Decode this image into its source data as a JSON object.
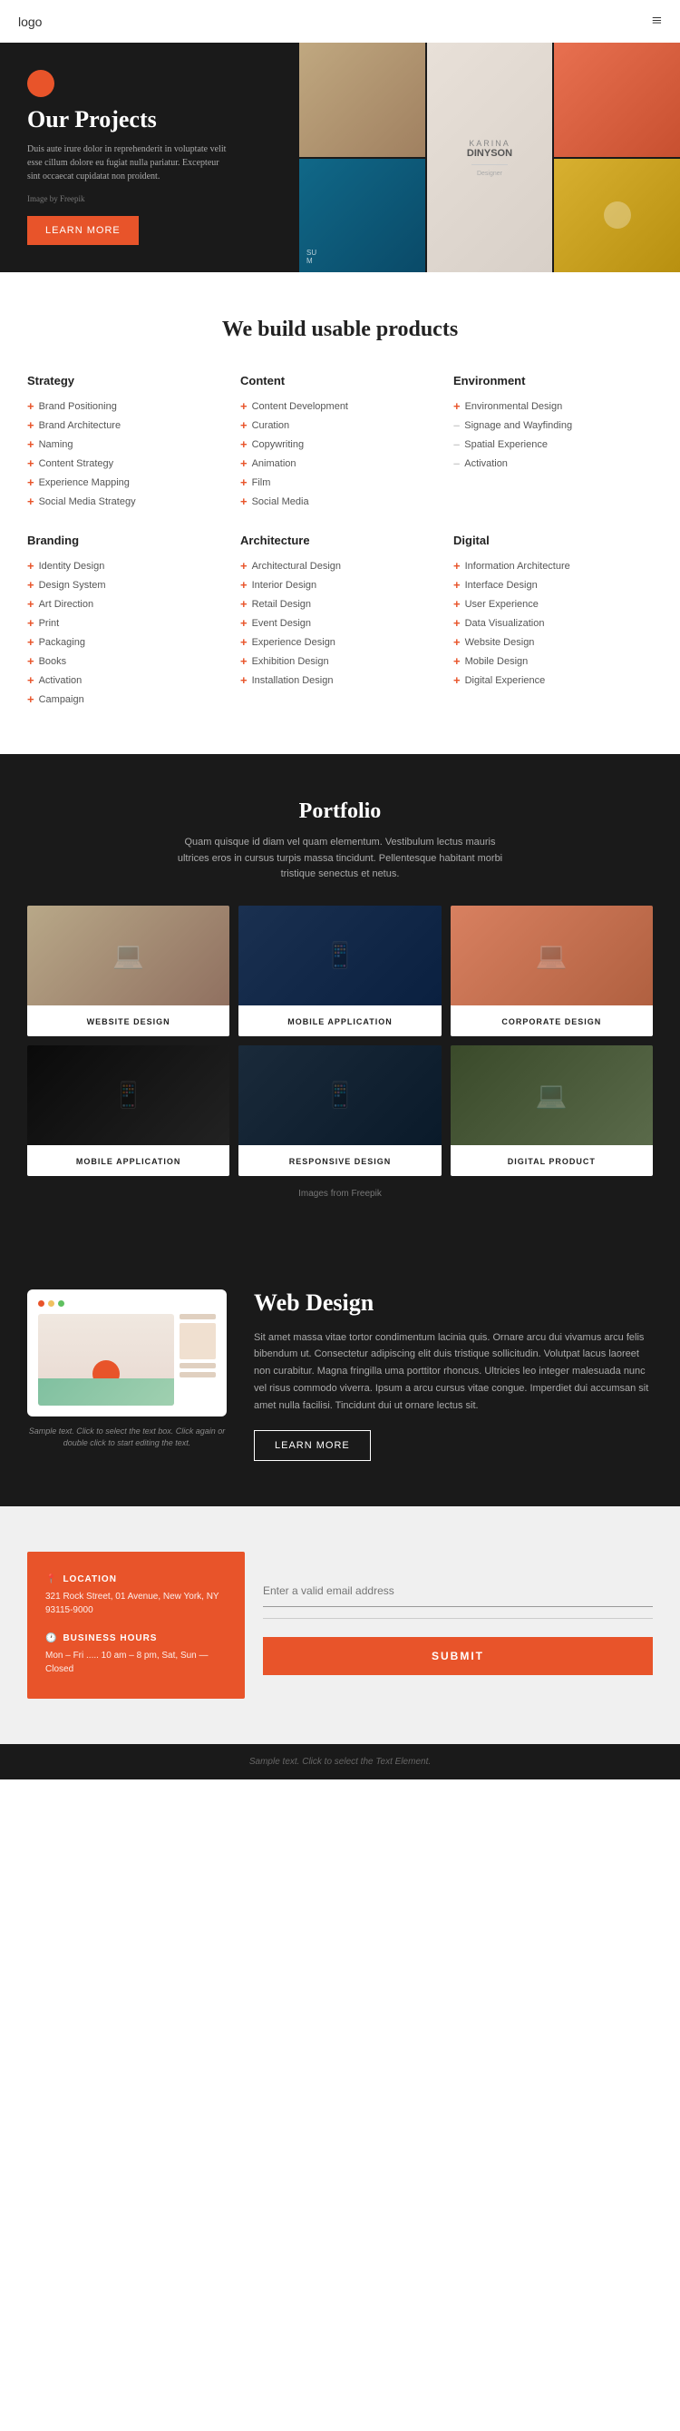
{
  "header": {
    "logo": "logo",
    "hamburger": "≡"
  },
  "hero": {
    "title": "Our Projects",
    "text": "Duis aute irure dolor in reprehenderit in voluptate velit esse cillum dolore eu fugiat nulla pariatur. Excepteur sint occaecat cupidatat non proident.",
    "image_credit": "Image by Freepik",
    "button_label": "LEARN MORE",
    "card_name": "KARINA",
    "card_surname": "DINYSON"
  },
  "services": {
    "title": "We build usable products",
    "columns": [
      {
        "heading": "Strategy",
        "items": [
          {
            "label": "Brand Positioning",
            "icon": "+"
          },
          {
            "label": "Brand Architecture",
            "icon": "+"
          },
          {
            "label": "Naming",
            "icon": "+"
          },
          {
            "label": "Content Strategy",
            "icon": "+"
          },
          {
            "label": "Experience Mapping",
            "icon": "+"
          },
          {
            "label": "Social Media Strategy",
            "icon": "+"
          }
        ]
      },
      {
        "heading": "Content",
        "items": [
          {
            "label": "Content Development",
            "icon": "+"
          },
          {
            "label": "Curation",
            "icon": "+"
          },
          {
            "label": "Copywriting",
            "icon": "+"
          },
          {
            "label": "Animation",
            "icon": "+"
          },
          {
            "label": "Film",
            "icon": "+"
          },
          {
            "label": "Social Media",
            "icon": "+"
          }
        ]
      },
      {
        "heading": "Environment",
        "items": [
          {
            "label": "Environmental Design",
            "icon": "+"
          },
          {
            "label": "Signage and Wayfinding",
            "icon": "–"
          },
          {
            "label": "Spatial Experience",
            "icon": "–"
          },
          {
            "label": "Activation",
            "icon": "–"
          }
        ]
      },
      {
        "heading": "Branding",
        "items": [
          {
            "label": "Identity Design",
            "icon": "+"
          },
          {
            "label": "Design System",
            "icon": "+"
          },
          {
            "label": "Art Direction",
            "icon": "+"
          },
          {
            "label": "Print",
            "icon": "+"
          },
          {
            "label": "Packaging",
            "icon": "+"
          },
          {
            "label": "Books",
            "icon": "+"
          },
          {
            "label": "Activation",
            "icon": "+"
          },
          {
            "label": "Campaign",
            "icon": "+"
          }
        ]
      },
      {
        "heading": "Architecture",
        "items": [
          {
            "label": "Architectural Design",
            "icon": "+"
          },
          {
            "label": "Interior Design",
            "icon": "+"
          },
          {
            "label": "Retail Design",
            "icon": "+"
          },
          {
            "label": "Event Design",
            "icon": "+"
          },
          {
            "label": "Experience Design",
            "icon": "+"
          },
          {
            "label": "Exhibition Design",
            "icon": "+"
          },
          {
            "label": "Installation Design",
            "icon": "+"
          }
        ]
      },
      {
        "heading": "Digital",
        "items": [
          {
            "label": "Information Architecture",
            "icon": "+"
          },
          {
            "label": "Interface Design",
            "icon": "+"
          },
          {
            "label": "User Experience",
            "icon": "+"
          },
          {
            "label": "Data Visualization",
            "icon": "+"
          },
          {
            "label": "Website Design",
            "icon": "+"
          },
          {
            "label": "Mobile Design",
            "icon": "+"
          },
          {
            "label": "Digital Experience",
            "icon": "+"
          }
        ]
      }
    ]
  },
  "portfolio": {
    "title": "Portfolio",
    "text": "Quam quisque id diam vel quam elementum. Vestibulum lectus mauris ultrices eros in cursus turpis massa tincidunt. Pellentesque habitant morbi tristique senectus et netus.",
    "items": [
      {
        "label": "WEBSITE DESIGN"
      },
      {
        "label": "MOBILE APPLICATION"
      },
      {
        "label": "CORPORATE DESIGN"
      },
      {
        "label": "MOBILE APPLICATION"
      },
      {
        "label": "RESPONSIVE DESIGN"
      },
      {
        "label": "DIGITAL PRODUCT"
      }
    ],
    "credit": "Images from Freepik"
  },
  "webdesign": {
    "title": "Web Design",
    "text": "Sit amet massa vitae tortor condimentum lacinia quis. Ornare arcu dui vivamus arcu felis bibendum ut. Consectetur adipiscing elit duis tristique sollicitudin. Volutpat lacus laoreet non curabitur. Magna fringilla uma porttitor rhoncus. Ultricies leo integer malesuada nunc vel risus commodo viverra. Ipsum a arcu cursus vitae congue. Imperdiet dui accumsan sit amet nulla facilisi. Tincidunt dui ut ornare lectus sit.",
    "button_label": "LEARN MORE",
    "caption": "Sample text. Click to select the text box. Click again or double click to start editing the text."
  },
  "contact": {
    "location_label": "LOCATION",
    "location_icon": "📍",
    "location_text": "321 Rock Street, 01 Avenue, New York, NY 93115-9000",
    "hours_label": "BUSINESS HOURS",
    "hours_icon": "🕐",
    "hours_text": "Mon – Fri ..... 10 am – 8 pm, Sat, Sun — Closed",
    "input_placeholder": "Enter a valid email address",
    "submit_label": "SUBMIT"
  },
  "footer": {
    "text": "Sample text. Click to select the Text Element."
  }
}
